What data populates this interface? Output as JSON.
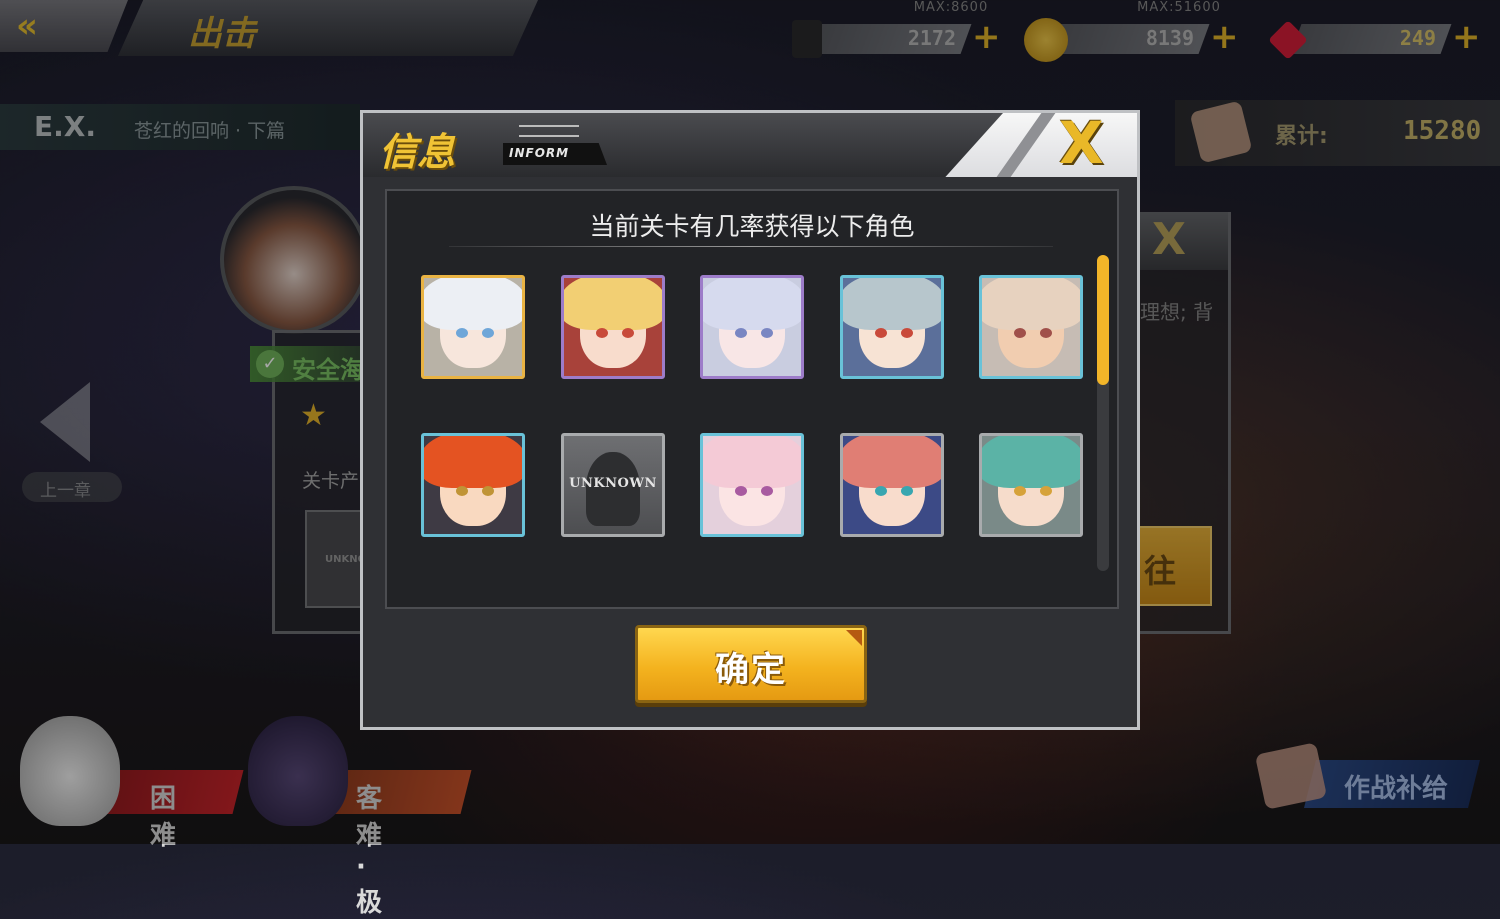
{
  "topbar": {
    "back_icon": "double-chevron-left-icon",
    "title": "出击",
    "resources": [
      {
        "name": "fuel",
        "icon": "fuel-icon",
        "max": "MAX:8600",
        "value": "2172",
        "plus": "+"
      },
      {
        "name": "coins",
        "icon": "coin-icon",
        "max": "MAX:51600",
        "value": "8139",
        "plus": "+"
      },
      {
        "name": "gems",
        "icon": "gem-icon",
        "max": "",
        "value": "249",
        "plus": "+"
      }
    ]
  },
  "stage": {
    "ex_label": "E.X.",
    "stage_name": "苍红的回响 · 下篇",
    "total_label": "累计:",
    "total_value": "15280",
    "safe_label": "安全海域",
    "stage_output_label": "关卡产出",
    "unknown_card": "UNKNOWN",
    "prev_stage": "上一章",
    "desc_fragment": "理想; 背",
    "go_label": "往",
    "bottom_buttons": [
      {
        "label": "困难",
        "color": "#c8242a"
      },
      {
        "label": "客难·极",
        "color": "#c9522a"
      }
    ],
    "supply_label": "作战补给"
  },
  "modal": {
    "title": "信息",
    "subtitle": "INFORM",
    "close": "X",
    "heading": "当前关卡有几率获得以下角色",
    "confirm": "确定",
    "characters": [
      {
        "id": "char-1",
        "rarity": "gold",
        "hair": "#eceff4",
        "face": "#f7e6dc",
        "eye": "#6fa6d8",
        "bg": "#b8b2a6"
      },
      {
        "id": "char-2",
        "rarity": "purple",
        "hair": "#f2cf73",
        "face": "#f8dccc",
        "eye": "#c84a3a",
        "bg": "#a8423a"
      },
      {
        "id": "char-3",
        "rarity": "purple",
        "hair": "#d6daee",
        "face": "#f8e6e6",
        "eye": "#7a86c2",
        "bg": "#c9cde0"
      },
      {
        "id": "char-4",
        "rarity": "blue",
        "hair": "#b7c6cc",
        "face": "#f7e3d4",
        "eye": "#c94a3a",
        "bg": "#5b6f9a"
      },
      {
        "id": "char-5",
        "rarity": "blue",
        "hair": "#e7d2bf",
        "face": "#f1cdb0",
        "eye": "#a0504a",
        "bg": "#c6bcb4"
      },
      {
        "id": "char-6",
        "rarity": "blue",
        "hair": "#e45322",
        "face": "#f9d9c0",
        "eye": "#c09436",
        "bg": "#3e3a44"
      },
      {
        "id": "char-7",
        "rarity": "grey",
        "unknown": true,
        "label": "UNKNOWN"
      },
      {
        "id": "char-8",
        "rarity": "blue",
        "hair": "#f4cad6",
        "face": "#fbe4e4",
        "eye": "#a85aa0",
        "bg": "#e4d0dc"
      },
      {
        "id": "char-9",
        "rarity": "grey",
        "hair": "#e07e74",
        "face": "#f8dccc",
        "eye": "#38a6b0",
        "bg": "#3c4a86"
      },
      {
        "id": "char-10",
        "rarity": "grey",
        "hair": "#5bb3a6",
        "face": "#f6dccb",
        "eye": "#d6a23a",
        "bg": "#7a8a88"
      }
    ]
  }
}
